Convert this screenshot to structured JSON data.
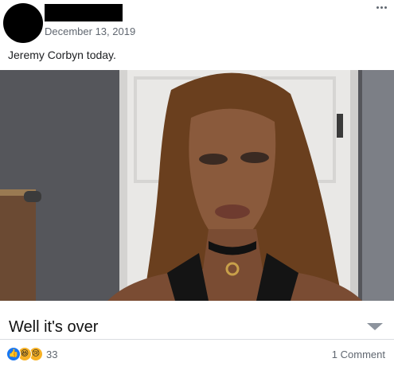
{
  "post": {
    "timestamp": "December 13, 2019",
    "text": "Jeremy Corbyn today.",
    "media": {
      "caption": "Well it's over"
    },
    "reactions": {
      "icons": [
        "like-icon",
        "haha-icon",
        "sad-icon"
      ],
      "count": "33"
    },
    "comments_label": "1 Comment"
  },
  "colors": {
    "meta_text": "#606770",
    "like_blue": "#1877f2",
    "emoji_yellow": "#f7b125"
  }
}
